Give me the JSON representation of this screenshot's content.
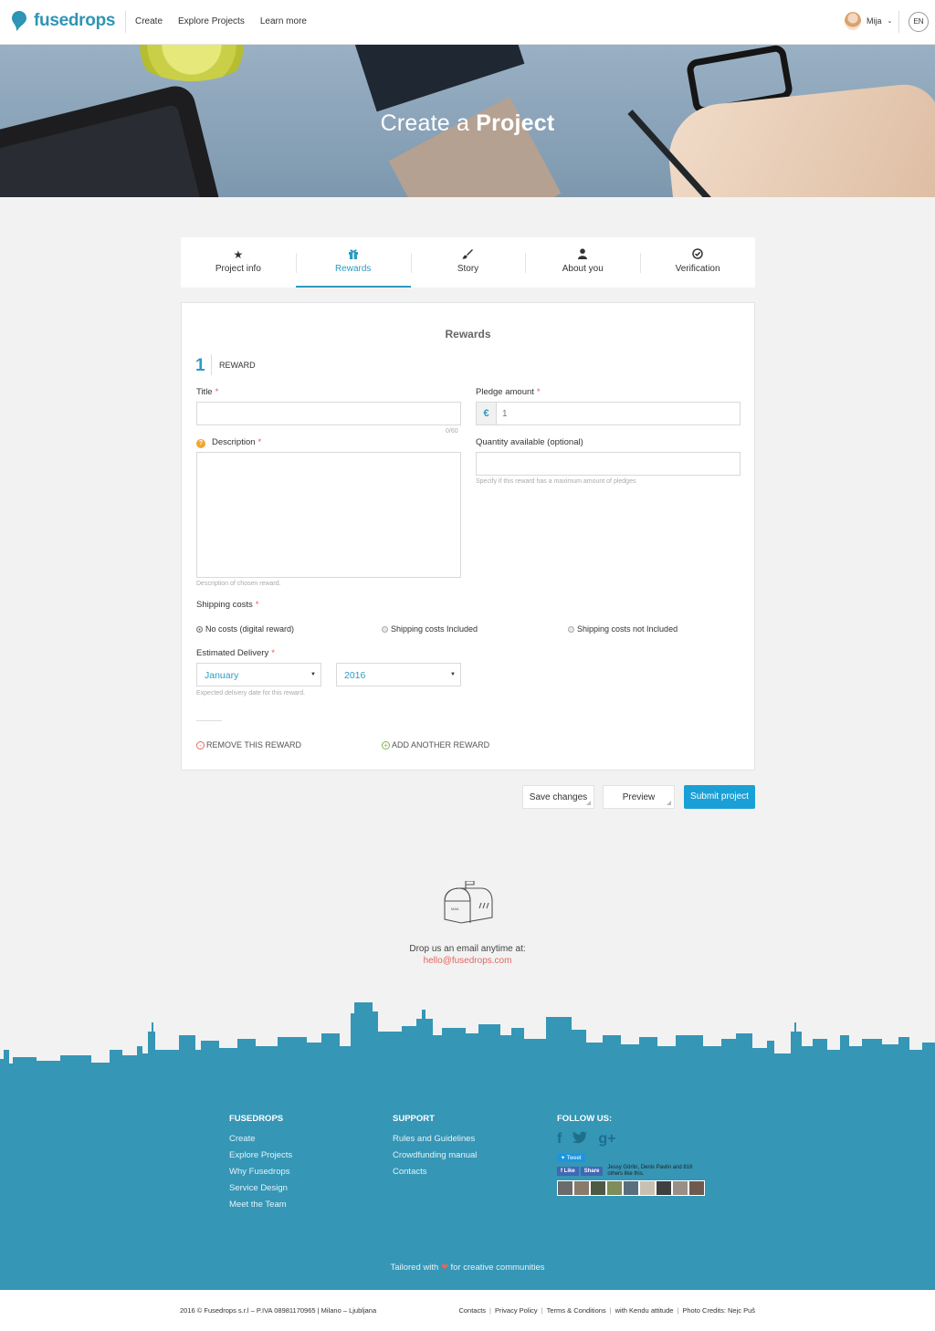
{
  "header": {
    "logo": "fusedrops",
    "nav": [
      "Create",
      "Explore Projects",
      "Learn more"
    ],
    "user_name": "Mija",
    "language": "EN"
  },
  "hero": {
    "title_light": "Create a",
    "title_bold": "Project"
  },
  "tabs": [
    {
      "label": "Project info",
      "icon": "star-icon"
    },
    {
      "label": "Rewards",
      "icon": "gift-icon",
      "active": true
    },
    {
      "label": "Story",
      "icon": "brush-icon"
    },
    {
      "label": "About you",
      "icon": "user-icon"
    },
    {
      "label": "Verification",
      "icon": "check-circle-icon"
    }
  ],
  "form": {
    "heading": "Rewards",
    "reward_number": "1",
    "reward_label": "REWARD",
    "title_label": "Title",
    "title_value": "",
    "title_counter": "0/60",
    "pledge_label": "Pledge amount",
    "currency": "€",
    "pledge_value": "1",
    "description_label": "Description",
    "description_value": "",
    "description_hint": "Description of chosen reward.",
    "quantity_label": "Quantity available (optional)",
    "quantity_value": "",
    "quantity_hint": "Specify if this reward has a maximum amount of pledges",
    "shipping_label": "Shipping costs",
    "shipping_options": [
      {
        "label": "No costs (digital reward)",
        "selected": true
      },
      {
        "label": "Shipping costs Included",
        "selected": false
      },
      {
        "label": "Shipping costs not Included",
        "selected": false
      }
    ],
    "delivery_label": "Estimated Delivery",
    "delivery_month": "January",
    "delivery_year": "2016",
    "delivery_hint": "Expected delivery date for this reward.",
    "remove_label": "REMOVE THIS REWARD",
    "add_label": "ADD ANOTHER REWARD",
    "required_mark": "*"
  },
  "actions": {
    "save": "Save changes",
    "preview": "Preview",
    "submit": "Submit project"
  },
  "contact": {
    "mailbox_text": "MAIL",
    "text": "Drop us an email anytime at:",
    "email": "hello@fusedrops.com"
  },
  "footer": {
    "col1": {
      "heading": "FUSEDROPS",
      "links": [
        "Create",
        "Explore Projects",
        "Why Fusedrops",
        "Service Design",
        "Meet the Team"
      ]
    },
    "col2": {
      "heading": "SUPPORT",
      "links": [
        "Rules and Guidelines",
        "Crowdfunding manual",
        "Contacts"
      ]
    },
    "col3": {
      "heading": "FOLLOW US:",
      "tweet": "Tweet",
      "fb_like": "Like",
      "fb_share": "Share",
      "fb_text": "Jessy Görlin, Denis Pavlin and 816 others like this."
    },
    "tagline_before": "Tailored with",
    "tagline_after": "for creative communities",
    "copyright": "2016 © Fusedrops s.r.l – P.IVA 08981170965  |  Milano – Ljubljana",
    "bottom_links": [
      "Contacts",
      "Privacy Policy",
      "Terms & Conditions",
      "with Kendu attitude",
      "Photo Credits: Nejc Puš"
    ]
  },
  "colors": {
    "brand": "#2f94b5",
    "accent": "#1aa0d6",
    "footer": "#3596b6",
    "link_red": "#e2685f"
  }
}
